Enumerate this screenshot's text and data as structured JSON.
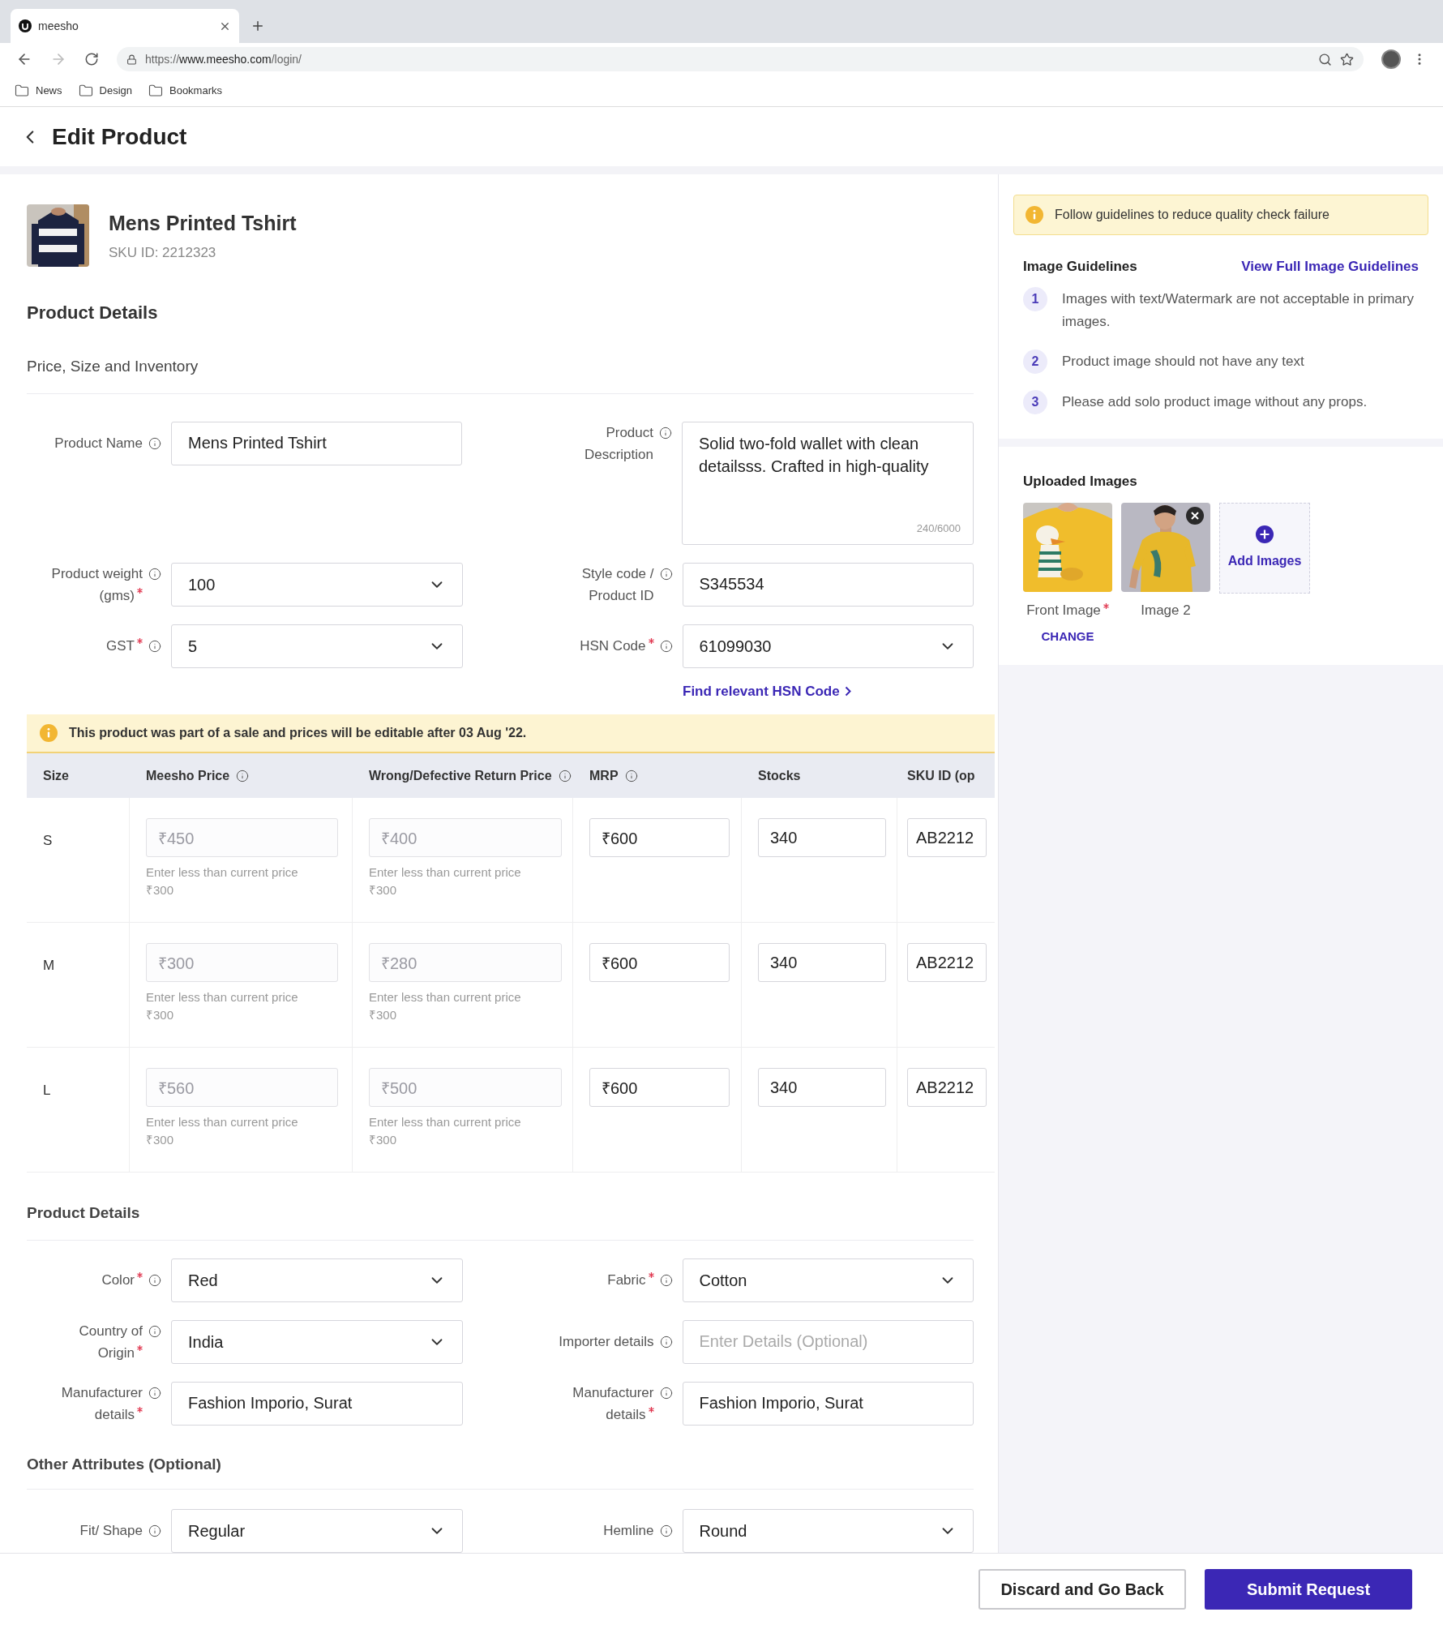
{
  "browser": {
    "tab_title": "meesho",
    "url_scheme": "https://",
    "url_host": "www.meesho.com",
    "url_path": "/login/",
    "bookmarks": [
      "News",
      "Design",
      "Bookmarks"
    ]
  },
  "page": {
    "title": "Edit Product"
  },
  "product": {
    "name": "Mens Printed Tshirt",
    "sku": "SKU ID: 2212323"
  },
  "details_title": "Product Details",
  "price_section": {
    "title": "Price, Size and Inventory",
    "rows": [
      [
        {
          "label": [
            "Product Name"
          ],
          "required": false,
          "kind": "input",
          "value": "Mens Printed Tshirt"
        },
        {
          "label": [
            "Product",
            "Description"
          ],
          "required": false,
          "kind": "textarea",
          "value": "Solid two-fold wallet with clean detailsss. Crafted in high-quality",
          "counter": "240/6000"
        }
      ],
      [
        {
          "label": [
            "Product weight",
            "(gms)"
          ],
          "required": true,
          "kind": "select",
          "value": "100"
        },
        {
          "label": [
            "Style code /",
            "Product ID"
          ],
          "required": false,
          "kind": "input",
          "value": "S345534"
        }
      ],
      [
        {
          "label": [
            "GST"
          ],
          "required": true,
          "kind": "select",
          "value": "5"
        },
        {
          "label": [
            "HSN Code"
          ],
          "required": true,
          "kind": "select",
          "value": "61099030"
        }
      ]
    ],
    "hsn_link": "Find relevant HSN Code"
  },
  "sale_notice": "This product was part of a sale and prices will be editable after 03 Aug '22.",
  "table": {
    "columns": [
      {
        "label": "Size",
        "info": false
      },
      {
        "label": "Meesho Price",
        "info": true
      },
      {
        "label": "Wrong/Defective Return Price",
        "info": true
      },
      {
        "label": "MRP",
        "info": true
      },
      {
        "label": "Stocks",
        "info": false
      },
      {
        "label": "SKU ID (op",
        "info": false
      }
    ],
    "rows": [
      {
        "cells": [
          {
            "kind": "text",
            "value": "S"
          },
          {
            "value": "₹450",
            "disabled": true,
            "hint": "Enter less than current price ₹300"
          },
          {
            "value": "₹400",
            "disabled": true,
            "hint": "Enter less than current price ₹300"
          },
          {
            "value": "₹600",
            "disabled": false
          },
          {
            "value": "340",
            "disabled": false
          },
          {
            "value": "AB2212",
            "disabled": false
          }
        ]
      },
      {
        "cells": [
          {
            "kind": "text",
            "value": "M"
          },
          {
            "value": "₹300",
            "disabled": true,
            "hint": "Enter less than current price ₹300"
          },
          {
            "value": "₹280",
            "disabled": true,
            "hint": "Enter less than current price ₹300"
          },
          {
            "value": "₹600",
            "disabled": false
          },
          {
            "value": "340",
            "disabled": false
          },
          {
            "value": "AB2212",
            "disabled": false
          }
        ]
      },
      {
        "cells": [
          {
            "kind": "text",
            "value": "L"
          },
          {
            "value": "₹560",
            "disabled": true,
            "hint": "Enter less than current price ₹300"
          },
          {
            "value": "₹500",
            "disabled": true,
            "hint": "Enter less than current price ₹300"
          },
          {
            "value": "₹600",
            "disabled": false
          },
          {
            "value": "340",
            "disabled": false
          },
          {
            "value": "AB2212",
            "disabled": false
          }
        ]
      }
    ]
  },
  "attributes": {
    "title": "Product Details",
    "rows": [
      [
        {
          "label": [
            "Color"
          ],
          "required": true,
          "kind": "select",
          "value": "Red"
        },
        {
          "label": [
            "Fabric"
          ],
          "required": true,
          "kind": "select",
          "value": "Cotton"
        }
      ],
      [
        {
          "label": [
            "Country of",
            "Origin"
          ],
          "required": true,
          "kind": "select",
          "value": "India"
        },
        {
          "label": [
            "Importer details"
          ],
          "required": false,
          "kind": "input",
          "placeholder": "Enter Details (Optional)"
        }
      ],
      [
        {
          "label": [
            "Manufacturer",
            "details"
          ],
          "required": true,
          "kind": "input",
          "value": "Fashion Imporio, Surat"
        },
        {
          "label": [
            "Manufacturer",
            "details"
          ],
          "required": true,
          "kind": "input",
          "value": "Fashion Imporio, Surat"
        }
      ]
    ]
  },
  "other_attributes": {
    "title": "Other Attributes (Optional)",
    "rows": [
      [
        {
          "label": [
            "Fit/ Shape"
          ],
          "required": false,
          "kind": "select",
          "value": "Regular"
        },
        {
          "label": [
            "Hemline"
          ],
          "required": false,
          "kind": "select",
          "value": "Round"
        }
      ]
    ]
  },
  "guidelines": {
    "notice": "Follow guidelines to reduce quality check failure",
    "title": "Image Guidelines",
    "link": "View Full Image Guidelines",
    "items": [
      {
        "number": "1",
        "text": "Images with text/Watermark are not acceptable in primary images."
      },
      {
        "number": "2",
        "text": "Product image should not have any text"
      },
      {
        "number": "3",
        "text": "Please add solo product image without any props."
      }
    ]
  },
  "uploaded": {
    "title": "Uploaded Images",
    "images": [
      {
        "label": "Front Image",
        "required": true,
        "removable": false,
        "action": "CHANGE",
        "kind": "flat"
      },
      {
        "label": "Image 2",
        "required": false,
        "removable": true,
        "kind": "model"
      }
    ],
    "add_label": "Add Images"
  },
  "footer": {
    "buttons": [
      {
        "label": "Discard and Go Back",
        "kind": "secondary"
      },
      {
        "label": "Submit Request",
        "kind": "primary"
      }
    ]
  }
}
